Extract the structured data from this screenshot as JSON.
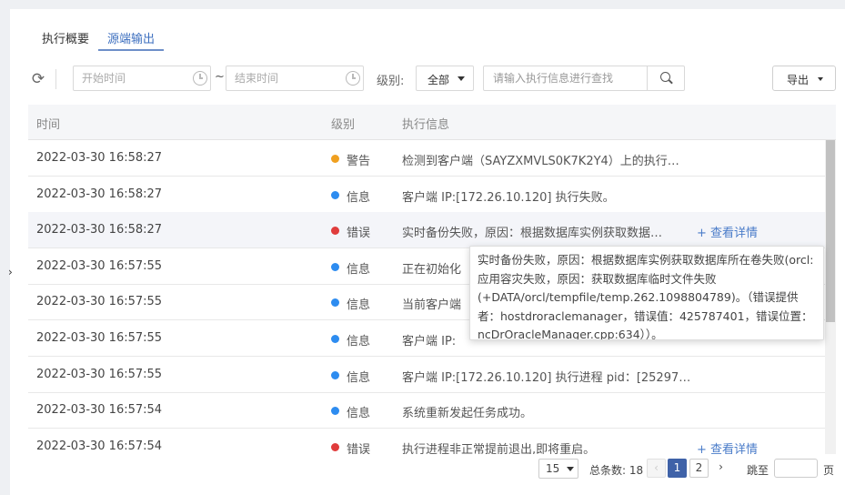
{
  "tabs": [
    {
      "label": "执行概要",
      "active": false
    },
    {
      "label": "源端输出",
      "active": true
    }
  ],
  "toolbar": {
    "start_placeholder": "开始时间",
    "end_placeholder": "结束时间",
    "range_sep": "~",
    "level_label": "级别:",
    "level_value": "全部",
    "search_placeholder": "请输入执行信息进行查找",
    "export_label": "导出"
  },
  "table": {
    "headers": {
      "time": "时间",
      "level": "级别",
      "message": "执行信息"
    },
    "rows": [
      {
        "time": "2022-03-30 16:58:27",
        "level": "警告",
        "level_color": "#f0a020",
        "message": "检测到客户端（SAYZXMVLS0K7K2Y4）上的执行…",
        "link": ""
      },
      {
        "time": "2022-03-30 16:58:27",
        "level": "信息",
        "level_color": "#2d8cf0",
        "message": "客户端 IP:[172.26.10.120] 执行失败。",
        "link": ""
      },
      {
        "time": "2022-03-30 16:58:27",
        "level": "错误",
        "level_color": "#e03c3c",
        "message": "实时备份失败，原因：根据数据库实例获取数据…",
        "link": "+ 查看详情"
      },
      {
        "time": "2022-03-30 16:57:55",
        "level": "信息",
        "level_color": "#2d8cf0",
        "message": "正在初始化",
        "link": ""
      },
      {
        "time": "2022-03-30 16:57:55",
        "level": "信息",
        "level_color": "#2d8cf0",
        "message": "当前客户端",
        "link": ""
      },
      {
        "time": "2022-03-30 16:57:55",
        "level": "信息",
        "level_color": "#2d8cf0",
        "message": "客户端 IP:",
        "link": ""
      },
      {
        "time": "2022-03-30 16:57:55",
        "level": "信息",
        "level_color": "#2d8cf0",
        "message": "客户端 IP:[172.26.10.120] 执行进程 pid：[25297…",
        "link": ""
      },
      {
        "time": "2022-03-30 16:57:54",
        "level": "信息",
        "level_color": "#2d8cf0",
        "message": "系统重新发起任务成功。",
        "link": ""
      },
      {
        "time": "2022-03-30 16:57:54",
        "level": "错误",
        "level_color": "#e03c3c",
        "message": "执行进程非正常提前退出,即将重启。",
        "link": "+ 查看详情"
      }
    ]
  },
  "tooltip": {
    "text": "实时备份失败，原因：根据数据库实例获取数据库所在卷失败(orcl:应用容灾失败，原因：获取数据库临时文件失败(+DATA/orcl/tempfile/temp.262.1098804789)。（错误提供者：hostdroraclemanager，错误值：425787401，错误位置：ncDrOracleManager.cpp:634））。"
  },
  "pagination": {
    "page_size": "15",
    "total": "总条数: 18",
    "prev": "‹",
    "pages": [
      "1",
      "2"
    ],
    "current": "1",
    "next": "›",
    "jump_label": "跳至",
    "page_unit": "页"
  },
  "side_mark": "›"
}
